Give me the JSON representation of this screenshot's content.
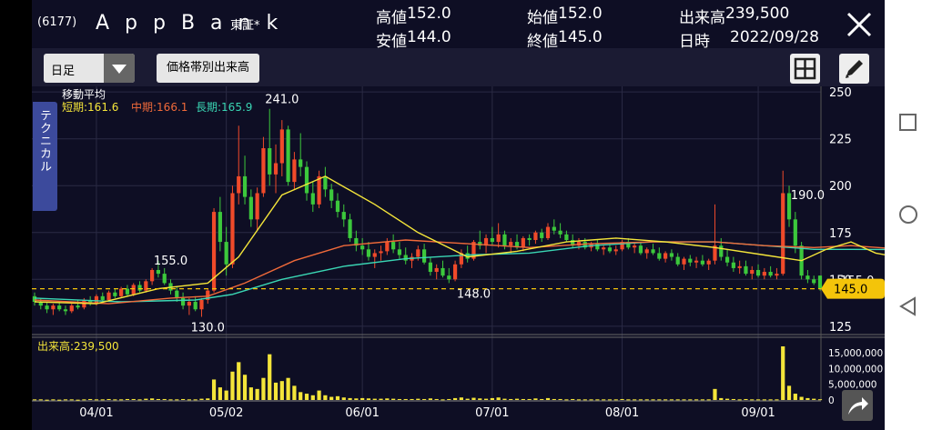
{
  "header": {
    "code": "(6177)",
    "name": "A p p B a n k",
    "market": "東証*",
    "high_label": "高値",
    "high_value": "152.0",
    "low_label": "安値",
    "low_value": "144.0",
    "open_label": "始値",
    "open_value": "152.0",
    "close_label": "終値",
    "close_value": "145.0",
    "volume_label": "出来高",
    "volume_value": "239,500",
    "date_label": "日時",
    "date_value": "2022/09/28"
  },
  "toolbar": {
    "period": "日足",
    "volume_by_price_label": "価格帯別出来高"
  },
  "side_tab": {
    "label": "テクニカル"
  },
  "icons": {
    "close": "close-icon",
    "period_dropdown": "chevron-down-icon",
    "layout": "grid-icon",
    "draw": "pencil-icon",
    "expand": "expand-arrow-icon",
    "nav_recent": "square-icon",
    "nav_home": "circle-icon",
    "nav_back": "triangle-back-icon"
  },
  "moving_average": {
    "title": "移動平均",
    "short": "短期:161.6",
    "mid": "中期:166.1",
    "long": "長期:165.9",
    "colors": {
      "short": "#f4e53a",
      "mid": "#f06a3a",
      "long": "#3ad6b4"
    }
  },
  "volume_panel": {
    "label": "出来高:239,500"
  },
  "colors": {
    "up": "#f04a2a",
    "down": "#3cc83c",
    "volume": "#f4e53a",
    "price_badge": "#f4c40a",
    "background": "#0e0e24",
    "toolbar": "#1b1b33",
    "side_tab": "#3c4a9c"
  },
  "chart_data": {
    "type": "candlestick",
    "x_ticks": [
      "04/01",
      "05/02",
      "06/01",
      "07/01",
      "08/01",
      "09/01"
    ],
    "price_axis": {
      "ticks": [
        250,
        225,
        200,
        175,
        150,
        125
      ],
      "ylim": [
        122,
        253
      ]
    },
    "volume_axis": {
      "ticks": [
        "15,000,000",
        "10,000,000",
        "5,000,000",
        "0"
      ],
      "ylim": [
        0,
        17000000
      ]
    },
    "current_price": "145.0",
    "annotations": [
      {
        "text": "241.0",
        "day": 40,
        "price": 241
      },
      {
        "text": "155.0",
        "day": 22,
        "price": 155
      },
      {
        "text": "130.0",
        "day": 28,
        "price": 130
      },
      {
        "text": "148.0",
        "day": 71,
        "price": 148
      },
      {
        "text": "190.0",
        "day": 125,
        "price": 190
      },
      {
        "text": "155.0",
        "day": 133,
        "price": 155
      }
    ],
    "ohlc": [
      [
        141,
        143,
        136,
        138
      ],
      [
        138,
        140,
        134,
        136
      ],
      [
        136,
        138,
        132,
        134
      ],
      [
        134,
        137,
        131,
        136
      ],
      [
        136,
        138,
        133,
        134
      ],
      [
        134,
        136,
        131,
        133
      ],
      [
        133,
        137,
        132,
        136
      ],
      [
        136,
        139,
        134,
        135
      ],
      [
        135,
        140,
        134,
        139
      ],
      [
        139,
        141,
        136,
        137
      ],
      [
        137,
        142,
        136,
        141
      ],
      [
        141,
        143,
        138,
        139
      ],
      [
        139,
        144,
        138,
        143
      ],
      [
        143,
        145,
        140,
        141
      ],
      [
        141,
        146,
        140,
        145
      ],
      [
        145,
        147,
        141,
        142
      ],
      [
        142,
        148,
        141,
        147
      ],
      [
        147,
        149,
        143,
        144
      ],
      [
        144,
        150,
        143,
        149
      ],
      [
        149,
        156,
        147,
        155
      ],
      [
        155,
        160,
        151,
        153
      ],
      [
        153,
        156,
        147,
        148
      ],
      [
        148,
        150,
        142,
        144
      ],
      [
        144,
        146,
        138,
        140
      ],
      [
        140,
        143,
        134,
        136
      ],
      [
        136,
        140,
        131,
        138
      ],
      [
        138,
        141,
        133,
        134
      ],
      [
        134,
        140,
        130,
        139
      ],
      [
        139,
        145,
        137,
        144
      ],
      [
        144,
        188,
        143,
        186
      ],
      [
        186,
        194,
        165,
        170
      ],
      [
        170,
        178,
        152,
        158
      ],
      [
        158,
        200,
        156,
        196
      ],
      [
        196,
        232,
        190,
        205
      ],
      [
        205,
        216,
        190,
        194
      ],
      [
        194,
        198,
        178,
        182
      ],
      [
        182,
        199,
        176,
        196
      ],
      [
        196,
        226,
        194,
        220
      ],
      [
        220,
        241,
        200,
        206
      ],
      [
        206,
        222,
        196,
        212
      ],
      [
        212,
        235,
        205,
        230
      ],
      [
        230,
        232,
        200,
        202
      ],
      [
        202,
        218,
        198,
        214
      ],
      [
        214,
        228,
        205,
        210
      ],
      [
        210,
        213,
        192,
        196
      ],
      [
        196,
        202,
        186,
        190
      ],
      [
        190,
        208,
        188,
        205
      ],
      [
        205,
        210,
        194,
        198
      ],
      [
        198,
        201,
        188,
        192
      ],
      [
        192,
        196,
        183,
        186
      ],
      [
        186,
        190,
        178,
        182
      ],
      [
        182,
        185,
        170,
        172
      ],
      [
        172,
        176,
        165,
        168
      ],
      [
        168,
        172,
        163,
        166
      ],
      [
        166,
        170,
        160,
        162
      ],
      [
        162,
        166,
        156,
        164
      ],
      [
        164,
        168,
        160,
        165
      ],
      [
        165,
        172,
        163,
        170
      ],
      [
        170,
        174,
        164,
        166
      ],
      [
        166,
        170,
        161,
        163
      ],
      [
        163,
        167,
        158,
        160
      ],
      [
        160,
        164,
        156,
        162
      ],
      [
        162,
        168,
        160,
        166
      ],
      [
        166,
        169,
        158,
        159
      ],
      [
        159,
        162,
        152,
        154
      ],
      [
        154,
        158,
        150,
        156
      ],
      [
        156,
        160,
        151,
        152
      ],
      [
        152,
        156,
        148,
        150
      ],
      [
        150,
        160,
        149,
        158
      ],
      [
        158,
        166,
        156,
        164
      ],
      [
        164,
        168,
        159,
        161
      ],
      [
        161,
        171,
        160,
        170
      ],
      [
        170,
        176,
        166,
        168
      ],
      [
        168,
        174,
        164,
        172
      ],
      [
        172,
        178,
        168,
        170
      ],
      [
        170,
        180,
        167,
        174
      ],
      [
        174,
        176,
        166,
        168
      ],
      [
        168,
        172,
        164,
        170
      ],
      [
        170,
        174,
        166,
        167
      ],
      [
        167,
        173,
        165,
        172
      ],
      [
        172,
        174,
        168,
        171
      ],
      [
        171,
        176,
        169,
        175
      ],
      [
        175,
        177,
        170,
        172
      ],
      [
        172,
        180,
        171,
        178
      ],
      [
        178,
        182,
        174,
        176
      ],
      [
        176,
        180,
        172,
        174
      ],
      [
        174,
        176,
        170,
        171
      ],
      [
        171,
        174,
        167,
        168
      ],
      [
        168,
        172,
        166,
        170
      ],
      [
        170,
        172,
        166,
        167
      ],
      [
        167,
        170,
        165,
        169
      ],
      [
        169,
        171,
        165,
        166
      ],
      [
        166,
        168,
        163,
        167
      ],
      [
        167,
        169,
        164,
        165
      ],
      [
        165,
        168,
        163,
        166
      ],
      [
        166,
        171,
        165,
        170
      ],
      [
        170,
        172,
        166,
        167
      ],
      [
        167,
        170,
        164,
        168
      ],
      [
        168,
        170,
        163,
        164
      ],
      [
        164,
        167,
        161,
        166
      ],
      [
        166,
        169,
        163,
        164
      ],
      [
        164,
        167,
        160,
        161
      ],
      [
        161,
        165,
        159,
        164
      ],
      [
        164,
        166,
        160,
        162
      ],
      [
        162,
        164,
        157,
        158
      ],
      [
        158,
        162,
        155,
        161
      ],
      [
        161,
        163,
        157,
        159
      ],
      [
        159,
        162,
        156,
        160
      ],
      [
        160,
        163,
        157,
        158
      ],
      [
        158,
        161,
        155,
        160
      ],
      [
        160,
        190,
        158,
        168
      ],
      [
        168,
        172,
        160,
        162
      ],
      [
        162,
        166,
        157,
        159
      ],
      [
        159,
        162,
        154,
        156
      ],
      [
        156,
        160,
        153,
        157
      ],
      [
        157,
        160,
        152,
        153
      ],
      [
        153,
        157,
        150,
        155
      ],
      [
        155,
        158,
        151,
        152
      ],
      [
        152,
        156,
        150,
        154
      ],
      [
        154,
        157,
        151,
        152
      ],
      [
        152,
        156,
        150,
        153
      ],
      [
        153,
        208,
        152,
        196
      ],
      [
        196,
        200,
        178,
        182
      ],
      [
        182,
        186,
        164,
        168
      ],
      [
        168,
        170,
        150,
        152
      ],
      [
        152,
        155,
        148,
        150
      ],
      [
        150,
        152,
        147,
        148
      ],
      [
        152,
        152,
        144,
        145
      ]
    ],
    "ma_short": [
      [
        0,
        138
      ],
      [
        10,
        137
      ],
      [
        20,
        145
      ],
      [
        28,
        148
      ],
      [
        33,
        162
      ],
      [
        40,
        195
      ],
      [
        47,
        205
      ],
      [
        55,
        190
      ],
      [
        62,
        175
      ],
      [
        70,
        162
      ],
      [
        78,
        165
      ],
      [
        86,
        170
      ],
      [
        94,
        172
      ],
      [
        102,
        170
      ],
      [
        110,
        167
      ],
      [
        118,
        163
      ],
      [
        124,
        160
      ],
      [
        128,
        166
      ],
      [
        132,
        170
      ],
      [
        136,
        164
      ],
      [
        140,
        161.6
      ]
    ],
    "ma_mid": [
      [
        0,
        139
      ],
      [
        12,
        137
      ],
      [
        22,
        140
      ],
      [
        28,
        141
      ],
      [
        34,
        148
      ],
      [
        42,
        160
      ],
      [
        50,
        168
      ],
      [
        60,
        171
      ],
      [
        70,
        169
      ],
      [
        80,
        167
      ],
      [
        90,
        169
      ],
      [
        100,
        170
      ],
      [
        110,
        170
      ],
      [
        118,
        168
      ],
      [
        126,
        167
      ],
      [
        132,
        168
      ],
      [
        140,
        166.1
      ]
    ],
    "ma_long": [
      [
        0,
        140
      ],
      [
        14,
        138
      ],
      [
        26,
        139
      ],
      [
        32,
        142
      ],
      [
        40,
        150
      ],
      [
        50,
        157
      ],
      [
        60,
        161
      ],
      [
        70,
        163
      ],
      [
        80,
        164
      ],
      [
        90,
        168
      ],
      [
        100,
        170
      ],
      [
        110,
        170
      ],
      [
        118,
        168
      ],
      [
        126,
        166
      ],
      [
        132,
        166
      ],
      [
        140,
        165.9
      ]
    ],
    "volume": [
      0.2,
      0.2,
      0.1,
      0.2,
      0.1,
      0.2,
      0.2,
      0.1,
      0.2,
      0.3,
      0.2,
      0.2,
      0.3,
      0.2,
      0.2,
      0.3,
      0.3,
      0.2,
      0.4,
      0.5,
      0.3,
      0.3,
      0.2,
      0.2,
      0.3,
      0.2,
      0.2,
      0.4,
      0.5,
      6.5,
      4.0,
      3.0,
      9.0,
      12.0,
      8.0,
      4.0,
      3.5,
      7.0,
      14.5,
      5.5,
      6.0,
      7.0,
      4.5,
      2.5,
      2.0,
      1.5,
      3.0,
      1.5,
      1.0,
      1.2,
      0.8,
      0.6,
      0.5,
      0.6,
      0.5,
      0.4,
      0.4,
      0.5,
      0.4,
      0.3,
      0.3,
      0.3,
      0.4,
      0.3,
      0.5,
      0.3,
      0.2,
      0.3,
      0.6,
      0.8,
      0.4,
      0.7,
      0.5,
      0.4,
      0.6,
      0.8,
      0.4,
      0.3,
      0.4,
      0.3,
      0.3,
      0.5,
      0.3,
      0.6,
      0.3,
      0.3,
      0.2,
      0.3,
      0.2,
      0.2,
      0.2,
      0.2,
      0.2,
      0.2,
      0.2,
      0.3,
      0.2,
      0.2,
      0.2,
      0.2,
      0.2,
      0.2,
      0.2,
      0.2,
      0.2,
      0.2,
      0.2,
      0.2,
      0.2,
      0.2,
      3.5,
      0.6,
      0.4,
      0.3,
      0.2,
      0.3,
      0.2,
      0.2,
      0.2,
      0.2,
      0.2,
      17.0,
      4.5,
      2.0,
      1.0,
      0.6,
      0.4,
      0.24
    ]
  }
}
